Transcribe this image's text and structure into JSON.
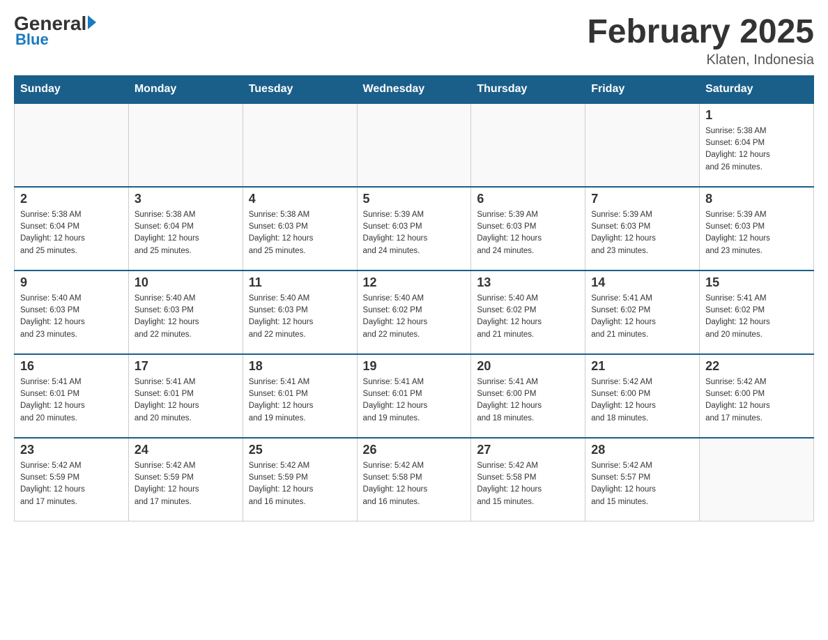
{
  "header": {
    "logo_general": "General",
    "logo_blue": "Blue",
    "month_title": "February 2025",
    "location": "Klaten, Indonesia"
  },
  "days_of_week": [
    "Sunday",
    "Monday",
    "Tuesday",
    "Wednesday",
    "Thursday",
    "Friday",
    "Saturday"
  ],
  "weeks": [
    [
      {
        "day": "",
        "info": ""
      },
      {
        "day": "",
        "info": ""
      },
      {
        "day": "",
        "info": ""
      },
      {
        "day": "",
        "info": ""
      },
      {
        "day": "",
        "info": ""
      },
      {
        "day": "",
        "info": ""
      },
      {
        "day": "1",
        "info": "Sunrise: 5:38 AM\nSunset: 6:04 PM\nDaylight: 12 hours\nand 26 minutes."
      }
    ],
    [
      {
        "day": "2",
        "info": "Sunrise: 5:38 AM\nSunset: 6:04 PM\nDaylight: 12 hours\nand 25 minutes."
      },
      {
        "day": "3",
        "info": "Sunrise: 5:38 AM\nSunset: 6:04 PM\nDaylight: 12 hours\nand 25 minutes."
      },
      {
        "day": "4",
        "info": "Sunrise: 5:38 AM\nSunset: 6:03 PM\nDaylight: 12 hours\nand 25 minutes."
      },
      {
        "day": "5",
        "info": "Sunrise: 5:39 AM\nSunset: 6:03 PM\nDaylight: 12 hours\nand 24 minutes."
      },
      {
        "day": "6",
        "info": "Sunrise: 5:39 AM\nSunset: 6:03 PM\nDaylight: 12 hours\nand 24 minutes."
      },
      {
        "day": "7",
        "info": "Sunrise: 5:39 AM\nSunset: 6:03 PM\nDaylight: 12 hours\nand 23 minutes."
      },
      {
        "day": "8",
        "info": "Sunrise: 5:39 AM\nSunset: 6:03 PM\nDaylight: 12 hours\nand 23 minutes."
      }
    ],
    [
      {
        "day": "9",
        "info": "Sunrise: 5:40 AM\nSunset: 6:03 PM\nDaylight: 12 hours\nand 23 minutes."
      },
      {
        "day": "10",
        "info": "Sunrise: 5:40 AM\nSunset: 6:03 PM\nDaylight: 12 hours\nand 22 minutes."
      },
      {
        "day": "11",
        "info": "Sunrise: 5:40 AM\nSunset: 6:03 PM\nDaylight: 12 hours\nand 22 minutes."
      },
      {
        "day": "12",
        "info": "Sunrise: 5:40 AM\nSunset: 6:02 PM\nDaylight: 12 hours\nand 22 minutes."
      },
      {
        "day": "13",
        "info": "Sunrise: 5:40 AM\nSunset: 6:02 PM\nDaylight: 12 hours\nand 21 minutes."
      },
      {
        "day": "14",
        "info": "Sunrise: 5:41 AM\nSunset: 6:02 PM\nDaylight: 12 hours\nand 21 minutes."
      },
      {
        "day": "15",
        "info": "Sunrise: 5:41 AM\nSunset: 6:02 PM\nDaylight: 12 hours\nand 20 minutes."
      }
    ],
    [
      {
        "day": "16",
        "info": "Sunrise: 5:41 AM\nSunset: 6:01 PM\nDaylight: 12 hours\nand 20 minutes."
      },
      {
        "day": "17",
        "info": "Sunrise: 5:41 AM\nSunset: 6:01 PM\nDaylight: 12 hours\nand 20 minutes."
      },
      {
        "day": "18",
        "info": "Sunrise: 5:41 AM\nSunset: 6:01 PM\nDaylight: 12 hours\nand 19 minutes."
      },
      {
        "day": "19",
        "info": "Sunrise: 5:41 AM\nSunset: 6:01 PM\nDaylight: 12 hours\nand 19 minutes."
      },
      {
        "day": "20",
        "info": "Sunrise: 5:41 AM\nSunset: 6:00 PM\nDaylight: 12 hours\nand 18 minutes."
      },
      {
        "day": "21",
        "info": "Sunrise: 5:42 AM\nSunset: 6:00 PM\nDaylight: 12 hours\nand 18 minutes."
      },
      {
        "day": "22",
        "info": "Sunrise: 5:42 AM\nSunset: 6:00 PM\nDaylight: 12 hours\nand 17 minutes."
      }
    ],
    [
      {
        "day": "23",
        "info": "Sunrise: 5:42 AM\nSunset: 5:59 PM\nDaylight: 12 hours\nand 17 minutes."
      },
      {
        "day": "24",
        "info": "Sunrise: 5:42 AM\nSunset: 5:59 PM\nDaylight: 12 hours\nand 17 minutes."
      },
      {
        "day": "25",
        "info": "Sunrise: 5:42 AM\nSunset: 5:59 PM\nDaylight: 12 hours\nand 16 minutes."
      },
      {
        "day": "26",
        "info": "Sunrise: 5:42 AM\nSunset: 5:58 PM\nDaylight: 12 hours\nand 16 minutes."
      },
      {
        "day": "27",
        "info": "Sunrise: 5:42 AM\nSunset: 5:58 PM\nDaylight: 12 hours\nand 15 minutes."
      },
      {
        "day": "28",
        "info": "Sunrise: 5:42 AM\nSunset: 5:57 PM\nDaylight: 12 hours\nand 15 minutes."
      },
      {
        "day": "",
        "info": ""
      }
    ]
  ]
}
